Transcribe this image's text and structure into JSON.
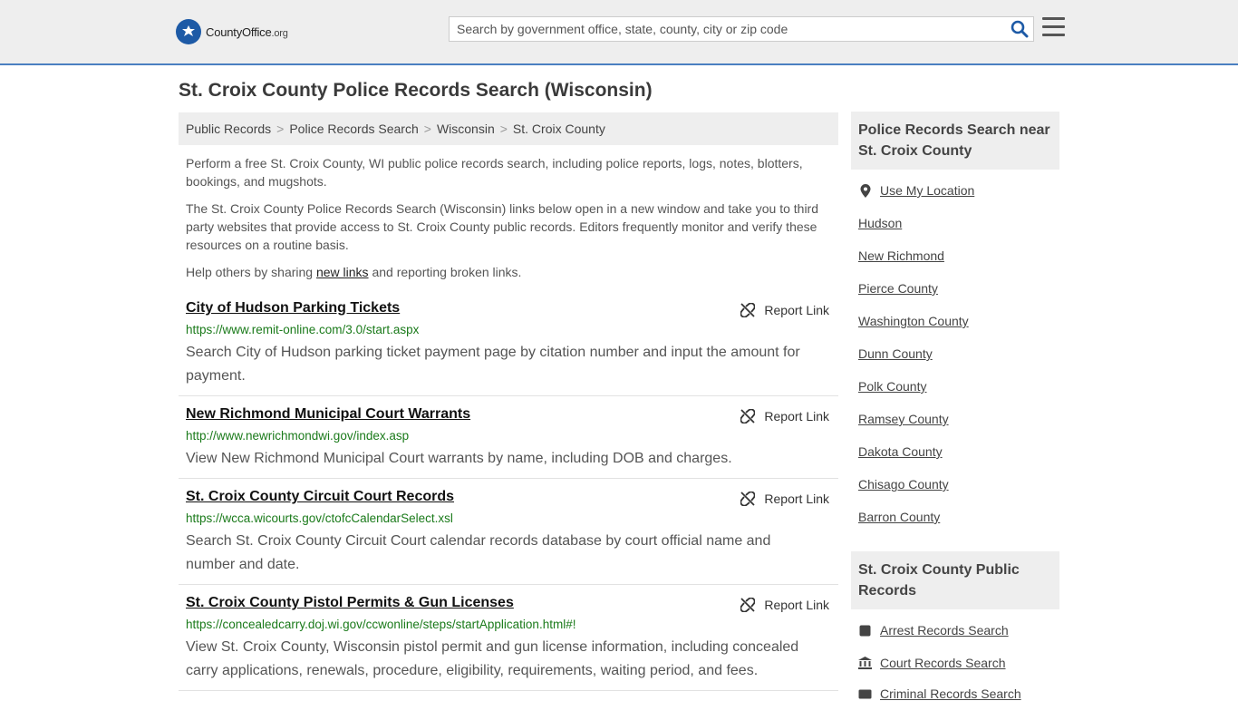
{
  "header": {
    "logo_main": "CountyOffice",
    "logo_suffix": ".org",
    "search_placeholder": "Search by government office, state, county, city or zip code"
  },
  "page_title": "St. Croix County Police Records Search (Wisconsin)",
  "breadcrumb": [
    "Public Records",
    "Police Records Search",
    "Wisconsin",
    "St. Croix County"
  ],
  "intro": {
    "p1": "Perform a free St. Croix County, WI public police records search, including police reports, logs, notes, blotters, bookings, and mugshots.",
    "p2": "The St. Croix County Police Records Search (Wisconsin) links below open in a new window and take you to third party websites that provide access to St. Croix County public records. Editors frequently monitor and verify these resources on a routine basis.",
    "p3_before": "Help others by sharing ",
    "p3_link": "new links",
    "p3_after": " and reporting broken links."
  },
  "report_label": "Report Link",
  "results": [
    {
      "title": "City of Hudson Parking Tickets",
      "url": "https://www.remit-online.com/3.0/start.aspx",
      "desc": "Search City of Hudson parking ticket payment page by citation number and input the amount for payment."
    },
    {
      "title": "New Richmond Municipal Court Warrants",
      "url": "http://www.newrichmondwi.gov/index.asp",
      "desc": "View New Richmond Municipal Court warrants by name, including DOB and charges."
    },
    {
      "title": "St. Croix County Circuit Court Records",
      "url": "https://wcca.wicourts.gov/ctofcCalendarSelect.xsl",
      "desc": "Search St. Croix County Circuit Court calendar records database by court official name and number and date."
    },
    {
      "title": "St. Croix County Pistol Permits & Gun Licenses",
      "url": "https://concealedcarry.doj.wi.gov/ccwonline/steps/startApplication.html#!",
      "desc": "View St. Croix County, Wisconsin pistol permit and gun license information, including concealed carry applications, renewals, procedure, eligibility, requirements, waiting period, and fees."
    }
  ],
  "sidebar": {
    "nearby_heading": "Police Records Search near St. Croix County",
    "use_location": "Use My Location",
    "nearby": [
      "Hudson",
      "New Richmond",
      "Pierce County",
      "Washington County",
      "Dunn County",
      "Polk County",
      "Ramsey County",
      "Dakota County",
      "Chisago County",
      "Barron County"
    ],
    "public_heading": "St. Croix County Public Records",
    "public_links": [
      "Arrest Records Search",
      "Court Records Search",
      "Criminal Records Search"
    ]
  },
  "icons": {
    "logo": "seal-icon",
    "search": "search-icon",
    "menu": "hamburger-menu-icon",
    "report": "broken-link-icon",
    "location": "map-pin-icon",
    "arrest": "square-icon",
    "court": "courthouse-icon",
    "criminal": "id-card-icon"
  },
  "colors": {
    "accent": "#1d5aa6",
    "url_green": "#1a7a1a",
    "header_bg": "#eeeeee"
  }
}
